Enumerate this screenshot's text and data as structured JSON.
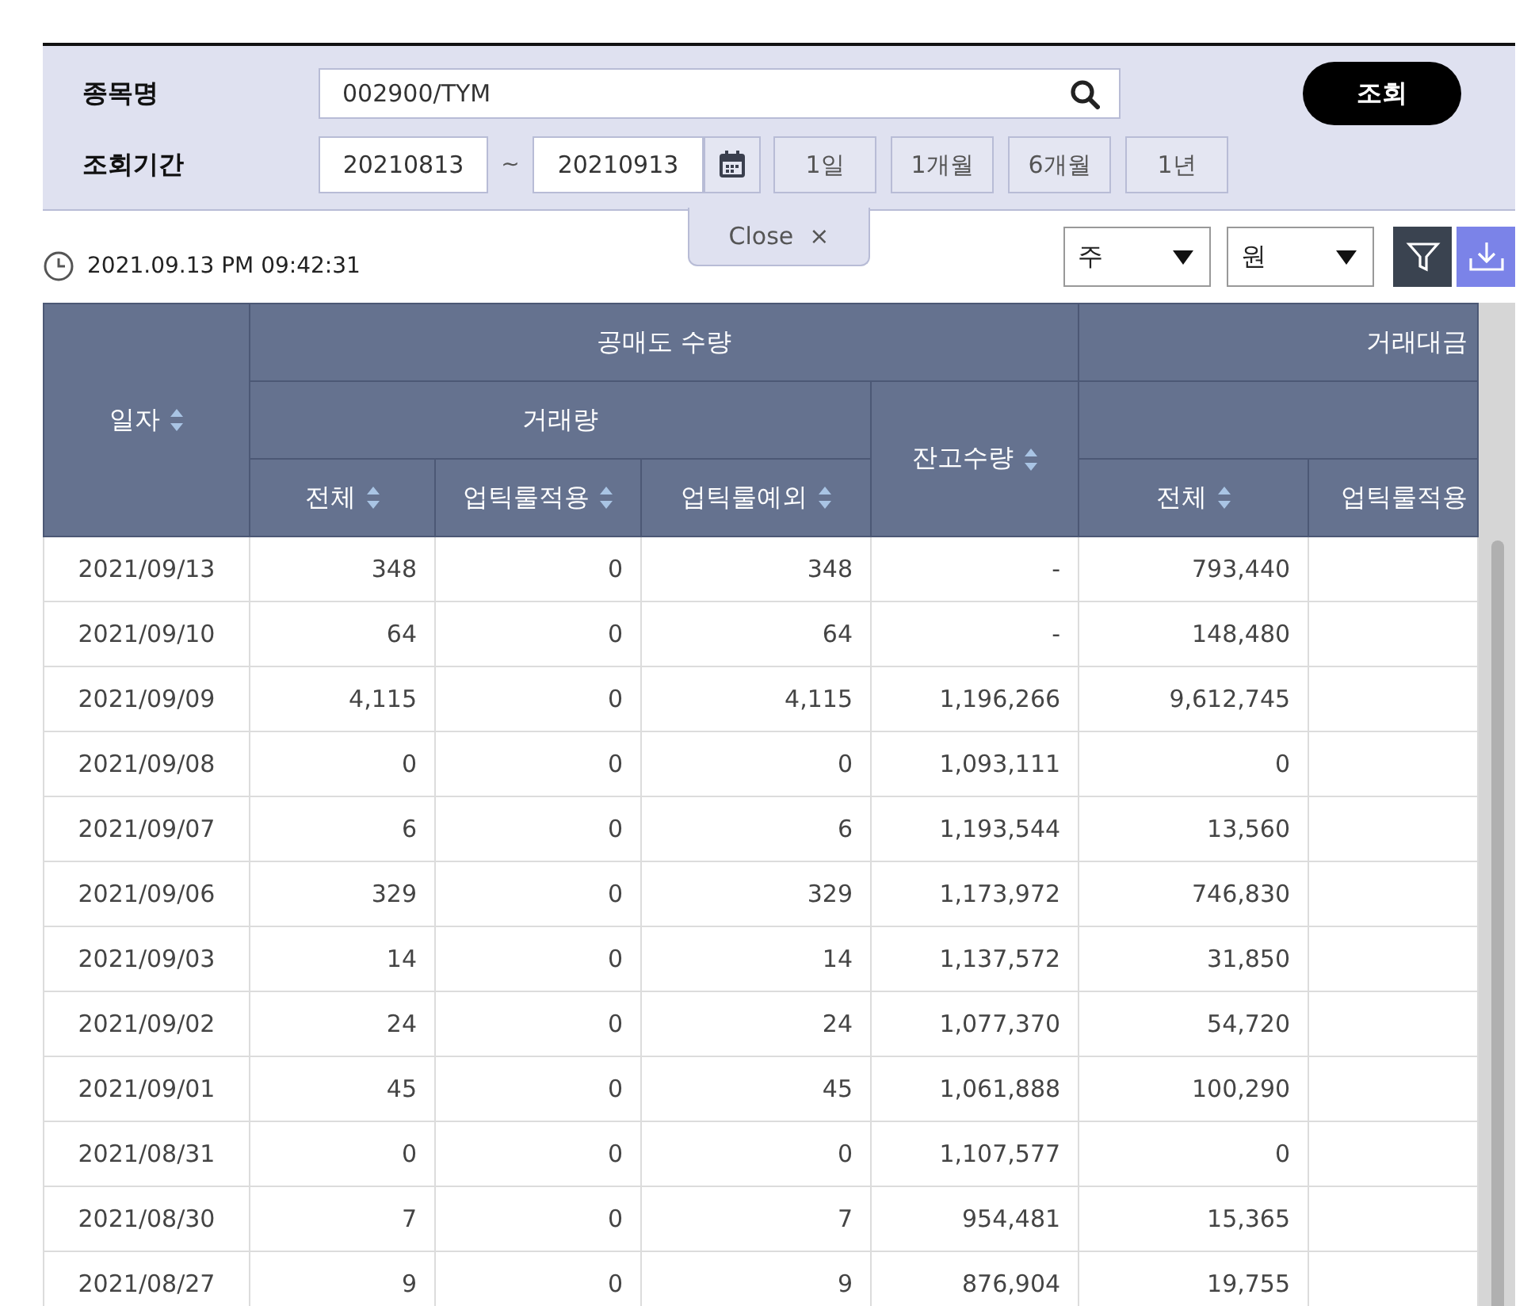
{
  "search": {
    "stock_label": "종목명",
    "stock_value": "002900/TYM",
    "submit": "조회",
    "period_label": "조회기간",
    "date_from": "20210813",
    "separator": "~",
    "date_to": "20210913",
    "quick_ranges": [
      "1일",
      "1개월",
      "6개월",
      "1년"
    ]
  },
  "close_tab": {
    "label": "Close",
    "icon": "×"
  },
  "timestamp": "2021.09.13 PM 09:42:31",
  "selects": [
    {
      "value": "주"
    },
    {
      "value": "원"
    }
  ],
  "table": {
    "groups": [
      "공매도 수량",
      "거래대금"
    ],
    "volume_header": "거래량",
    "columns": [
      {
        "label": "일자",
        "sortable": true
      },
      {
        "label": "전체",
        "sortable": true
      },
      {
        "label": "업틱룰적용",
        "sortable": true
      },
      {
        "label": "업틱룰예외",
        "sortable": true
      },
      {
        "label": "잔고수량",
        "sortable": true
      },
      {
        "label": "전체",
        "sortable": true
      },
      {
        "label": "업틱룰적용",
        "sortable": false
      }
    ],
    "rows": [
      [
        "2021/09/13",
        "348",
        "0",
        "348",
        "-",
        "793,440"
      ],
      [
        "2021/09/10",
        "64",
        "0",
        "64",
        "-",
        "148,480"
      ],
      [
        "2021/09/09",
        "4,115",
        "0",
        "4,115",
        "1,196,266",
        "9,612,745"
      ],
      [
        "2021/09/08",
        "0",
        "0",
        "0",
        "1,093,111",
        "0"
      ],
      [
        "2021/09/07",
        "6",
        "0",
        "6",
        "1,193,544",
        "13,560"
      ],
      [
        "2021/09/06",
        "329",
        "0",
        "329",
        "1,173,972",
        "746,830"
      ],
      [
        "2021/09/03",
        "14",
        "0",
        "14",
        "1,137,572",
        "31,850"
      ],
      [
        "2021/09/02",
        "24",
        "0",
        "24",
        "1,077,370",
        "54,720"
      ],
      [
        "2021/09/01",
        "45",
        "0",
        "45",
        "1,061,888",
        "100,290"
      ],
      [
        "2021/08/31",
        "0",
        "0",
        "0",
        "1,107,577",
        "0"
      ],
      [
        "2021/08/30",
        "7",
        "0",
        "7",
        "954,481",
        "15,365"
      ],
      [
        "2021/08/27",
        "9",
        "0",
        "9",
        "876,904",
        "19,755"
      ]
    ]
  }
}
